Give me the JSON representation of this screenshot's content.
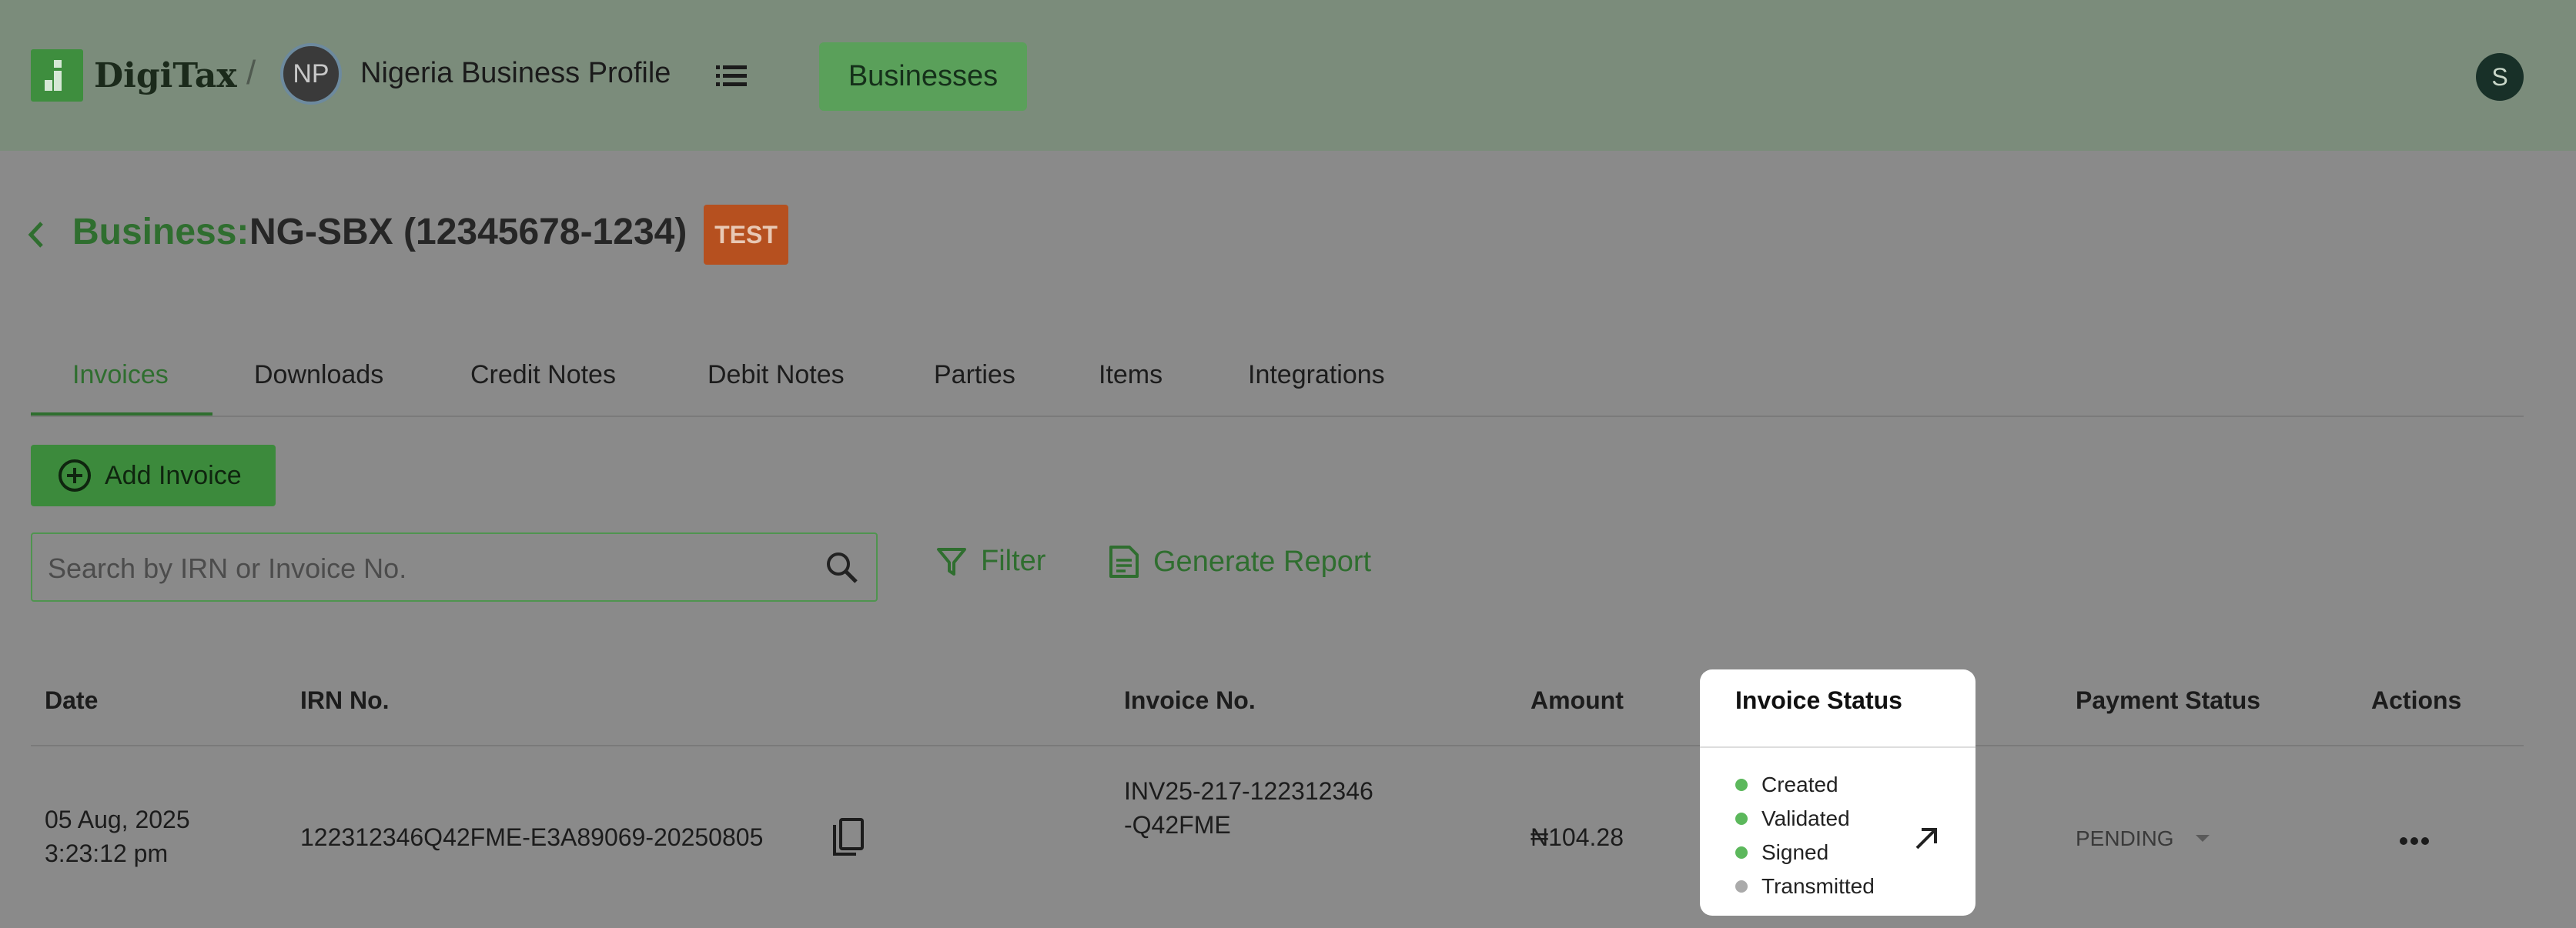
{
  "header": {
    "brand": "DigiTax",
    "separator": "/",
    "profile_initials": "NP",
    "profile_name": "Nigeria Business Profile",
    "businesses_button": "Businesses",
    "user_initial": "S"
  },
  "page": {
    "title_label": "Business:",
    "title_value": "NG-SBX (12345678-1234)",
    "badge": "TEST"
  },
  "tabs": [
    {
      "label": "Invoices",
      "active": true
    },
    {
      "label": "Downloads"
    },
    {
      "label": "Credit Notes"
    },
    {
      "label": "Debit Notes"
    },
    {
      "label": "Parties"
    },
    {
      "label": "Items"
    },
    {
      "label": "Integrations"
    }
  ],
  "toolbar": {
    "add_invoice": "Add Invoice",
    "search_placeholder": "Search by IRN or Invoice No.",
    "filter": "Filter",
    "generate_report": "Generate Report"
  },
  "table": {
    "columns": [
      "Date",
      "IRN No.",
      "Invoice No.",
      "Amount",
      "Invoice Status",
      "Payment Status",
      "Actions"
    ],
    "rows": [
      {
        "date_line1": "05 Aug, 2025",
        "date_line2": "3:23:12 pm",
        "irn": "122312346Q42FME-E3A89069-20250805",
        "invoice_line1": "INV25-217-122312346",
        "invoice_line2": "-Q42FME",
        "amount": "₦104.28",
        "statuses": [
          {
            "label": "Created",
            "color": "#5cb85c"
          },
          {
            "label": "Validated",
            "color": "#5cb85c"
          },
          {
            "label": "Signed",
            "color": "#5cb85c"
          },
          {
            "label": "Transmitted",
            "color": "#aaaaaa"
          }
        ],
        "payment_status": "PENDING"
      }
    ]
  },
  "colors": {
    "header_bg": "#7b8c7b",
    "page_bg": "#8a8a8a",
    "accent": "#2f6e2f",
    "badge": "#b6501f"
  }
}
